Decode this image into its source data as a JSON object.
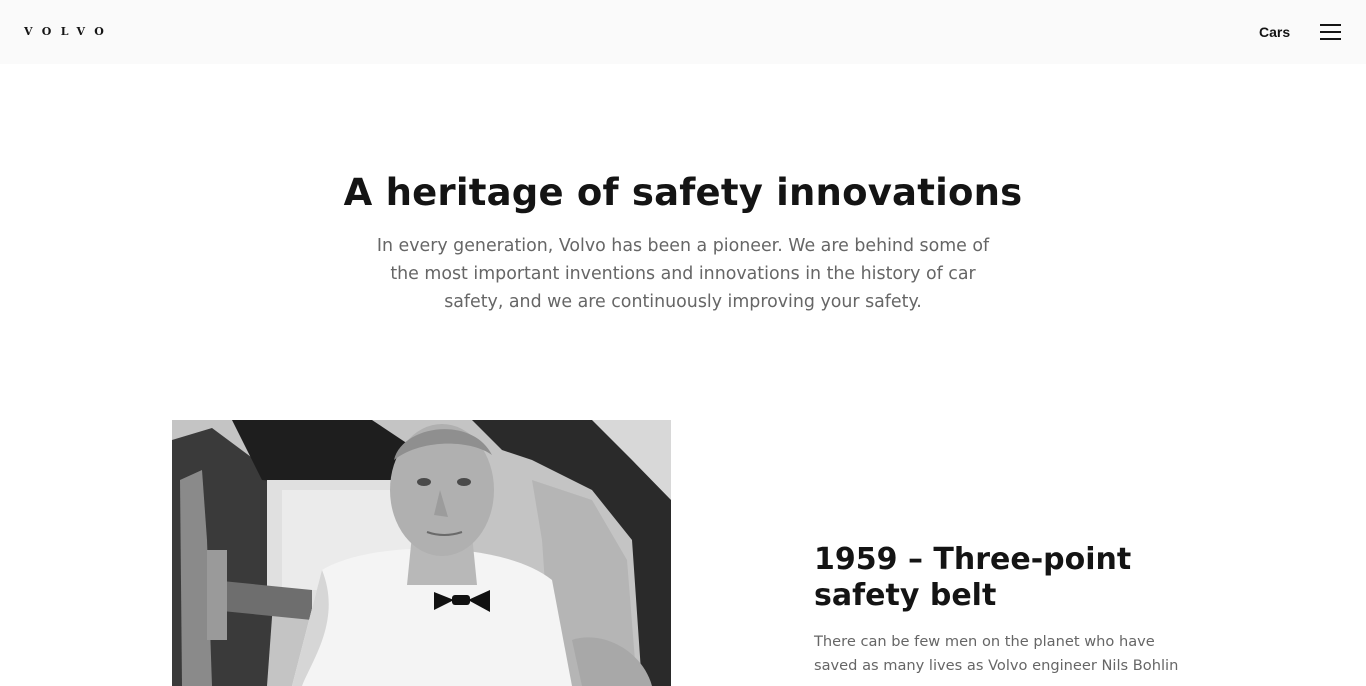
{
  "header": {
    "logo_text": "VOLVO",
    "nav_cars_label": "Cars",
    "menu_icon": "hamburger-menu-icon"
  },
  "hero": {
    "title": "A heritage of safety innovations",
    "text": "In every generation, Volvo has been a pioneer. We are behind some of the most important inventions and innovations in the history of car safety, and we are continuously improving your safety."
  },
  "feature": {
    "title": "1959 – Three-point safety belt",
    "text": "There can be few men on the planet who have saved as many lives as Volvo engineer Nils Bohlin –"
  }
}
